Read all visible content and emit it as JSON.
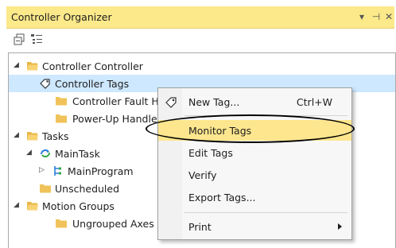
{
  "panel": {
    "title": "Controller Organizer",
    "title_controls": [
      "▾",
      "⊣",
      "✕"
    ]
  },
  "tree": {
    "rows": [
      {
        "label": "Controller Controller",
        "expander": "◢",
        "icon": "folder-open-icon"
      },
      {
        "label": "Controller Tags",
        "icon": "tag-icon",
        "selected": true
      },
      {
        "label": "Controller Fault Handler",
        "icon": "folder-icon"
      },
      {
        "label": "Power-Up Handler",
        "icon": "folder-icon"
      },
      {
        "label": "Tasks",
        "expander": "◢",
        "icon": "folder-open-icon"
      },
      {
        "label": "MainTask",
        "expander": "◢",
        "icon": "task-cycle-icon"
      },
      {
        "label": "MainProgram",
        "expander": "▷",
        "icon": "program-icon"
      },
      {
        "label": "Unscheduled",
        "icon": "folder-icon"
      },
      {
        "label": "Motion Groups",
        "expander": "◢",
        "icon": "folder-open-icon"
      },
      {
        "label": "Ungrouped Axes",
        "icon": "folder-icon"
      }
    ]
  },
  "context_menu": {
    "items": [
      {
        "label": "New Tag...",
        "shortcut": "Ctrl+W",
        "icon": "tag-icon"
      },
      {
        "label": "Monitor Tags",
        "highlighted": true
      },
      {
        "label": "Edit Tags"
      },
      {
        "label": "Verify"
      },
      {
        "label": "Export Tags..."
      },
      {
        "label": "Print",
        "submenu": true
      }
    ]
  },
  "colors": {
    "title_bar": "#fbe98a",
    "selection": "#cde8ff",
    "menu_highlight": "#fde68e",
    "folder": "#f0c35a"
  }
}
